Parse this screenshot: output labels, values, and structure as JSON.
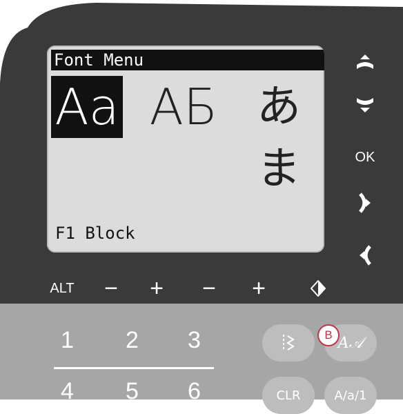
{
  "lcd": {
    "title": "Font Menu",
    "fonts": [
      {
        "label": "Aa",
        "selected": true
      },
      {
        "label": "AБ",
        "selected": false
      },
      {
        "label": "あま",
        "selected": false
      }
    ],
    "footer": "F1 Block"
  },
  "side_buttons": {
    "up_icon": "up-arrow-icon",
    "down_icon": "down-arrow-icon",
    "ok_label": "OK",
    "right_icon": "right-bracket-icon",
    "left_icon": "left-bracket-icon"
  },
  "bottom_row": {
    "alt_label": "ALT",
    "minus1": "−",
    "plus1": "+",
    "minus2": "−",
    "plus2": "+",
    "diamond_icon": "mirror-diamond-icon"
  },
  "keypad": {
    "keys_row1": [
      "1",
      "2",
      "3"
    ],
    "keys_row2": [
      "4",
      "5",
      "6"
    ],
    "btn_stitch_icon": "stitch-icon",
    "btn_font_label": "A𝒜",
    "btn_clr_label": "CLR",
    "btn_case_label": "A/a/1",
    "badge_label": "B"
  },
  "colors": {
    "panel_dark": "#3a3a3a",
    "panel_light": "#a6a6a6",
    "lcd_bg": "#dcdcdc",
    "badge": "#c0344a"
  }
}
